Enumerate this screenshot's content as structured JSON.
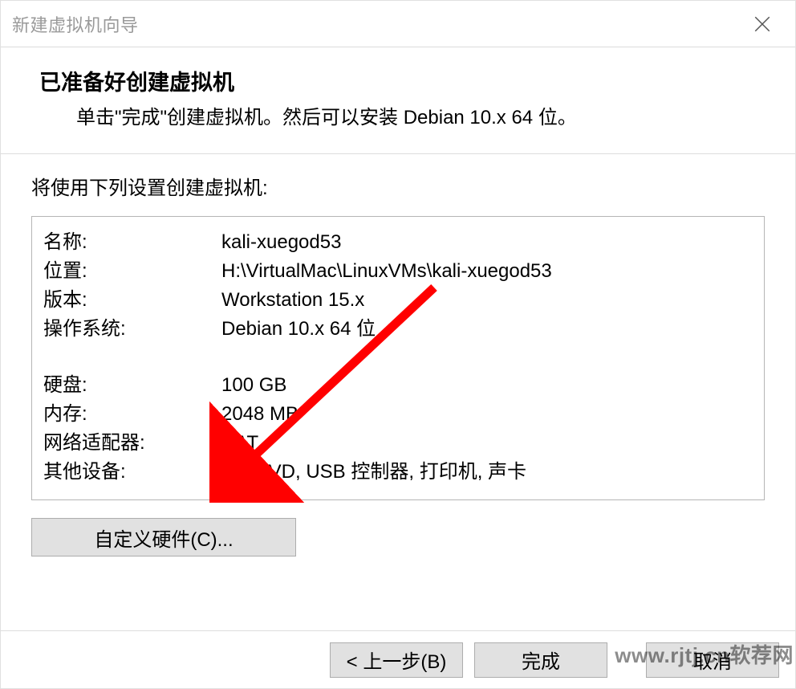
{
  "window": {
    "title": "新建虚拟机向导"
  },
  "header": {
    "heading": "已准备好创建虚拟机",
    "subtitle": "单击\"完成\"创建虚拟机。然后可以安装 Debian 10.x 64 位。"
  },
  "body": {
    "intro": "将使用下列设置创建虚拟机:",
    "rows_top": [
      {
        "label": "名称:",
        "value": "kali-xuegod53"
      },
      {
        "label": "位置:",
        "value": "H:\\VirtualMac\\LinuxVMs\\kali-xuegod53"
      },
      {
        "label": "版本:",
        "value": "Workstation 15.x"
      },
      {
        "label": "操作系统:",
        "value": "Debian 10.x 64 位"
      }
    ],
    "rows_bottom": [
      {
        "label": "硬盘:",
        "value": "100 GB"
      },
      {
        "label": "内存:",
        "value": "2048 MB"
      },
      {
        "label": "网络适配器:",
        "value": "NAT"
      },
      {
        "label": "其他设备:",
        "value": "CD/DVD, USB 控制器, 打印机, 声卡"
      }
    ]
  },
  "buttons": {
    "customize": "自定义硬件(C)...",
    "back": "< 上一步(B)",
    "finish": "完成",
    "cancel": "取消"
  },
  "watermark": "www.rjtj.cn软荐网",
  "annotation": {
    "arrow_color": "#ff0000"
  }
}
